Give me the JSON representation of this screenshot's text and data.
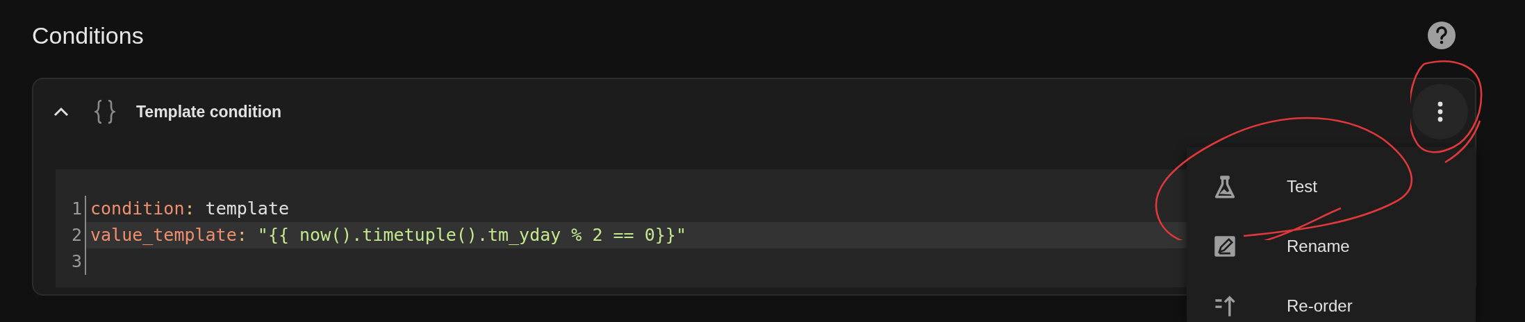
{
  "section": {
    "title": "Conditions"
  },
  "condition": {
    "title": "Template condition",
    "expanded": true,
    "code_lines": [
      {
        "number": "1",
        "highlighted": false,
        "tokens": [
          {
            "kind": "key",
            "text": "condition"
          },
          {
            "kind": "punct",
            "text": ": "
          },
          {
            "kind": "plain",
            "text": "template"
          }
        ]
      },
      {
        "number": "2",
        "highlighted": true,
        "tokens": [
          {
            "kind": "key",
            "text": "value_template"
          },
          {
            "kind": "punct",
            "text": ": "
          },
          {
            "kind": "string",
            "text": "\"{{ now().timetuple().tm_yday % 2 == 0}}\""
          }
        ]
      },
      {
        "number": "3",
        "highlighted": false
      }
    ]
  },
  "menu": {
    "items": [
      {
        "kind": "test",
        "label": "Test"
      },
      {
        "kind": "rename",
        "label": "Rename"
      },
      {
        "kind": "reorder",
        "label": "Re-order"
      }
    ]
  }
}
